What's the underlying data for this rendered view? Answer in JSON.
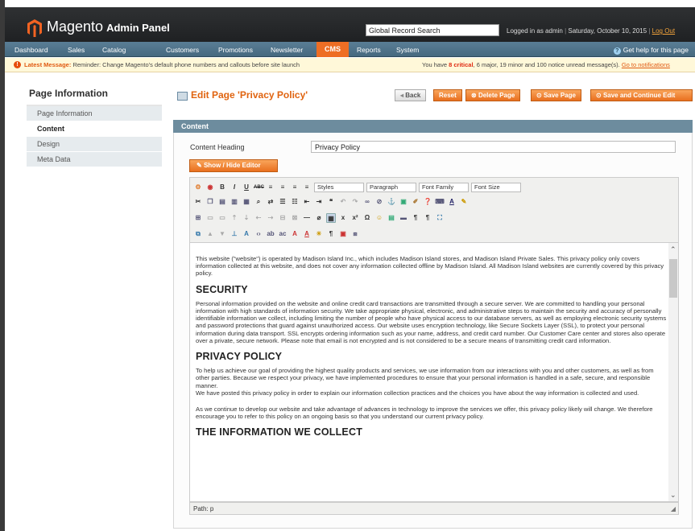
{
  "header": {
    "logo_main": "Magento",
    "logo_sub": "Admin Panel",
    "search_value": "Global Record Search",
    "logged_in": "Logged in as admin",
    "date": "Saturday, October 10, 2015",
    "logout": "Log Out"
  },
  "nav": {
    "items": [
      "Dashboard",
      "Sales",
      "Catalog",
      "Customers",
      "Promotions",
      "Newsletter",
      "CMS",
      "Reports",
      "System"
    ],
    "help": "Get help for this page"
  },
  "message": {
    "label": "Latest Message:",
    "text": "Reminder: Change Magento's default phone numbers and callouts before site launch",
    "pre": "You have",
    "critical": "8 critical",
    "rest": ", 6 major, 19 minor and 100 notice unread message(s).",
    "link": "Go to notifications"
  },
  "sidebar": {
    "title": "Page Information",
    "items": [
      {
        "label": "Page Information"
      },
      {
        "label": "Content"
      },
      {
        "label": "Design"
      },
      {
        "label": "Meta Data"
      }
    ]
  },
  "page": {
    "title": "Edit Page 'Privacy Policy'",
    "buttons": {
      "back": "Back",
      "reset": "Reset",
      "delete": "Delete Page",
      "save": "Save Page",
      "save_continue": "Save and Continue Edit"
    }
  },
  "content": {
    "section_title": "Content",
    "heading_label": "Content Heading",
    "heading_value": "Privacy Policy",
    "toggle_editor": "Show / Hide Editor",
    "toolbar": {
      "styles": "Styles",
      "format": "Paragraph",
      "font_family": "Font Family",
      "font_size": "Font Size"
    },
    "editor": {
      "intro": "This website (\"website\") is operated by Madison Island Inc., which includes Madison Island stores, and Madison Island Private Sales. This privacy policy only covers information collected at this website, and does not cover any information collected offline by Madison Island. All Madison Island websites are currently covered by this privacy policy.",
      "h_security": "SECURITY",
      "security": "Personal information provided on the website and online credit card transactions are transmitted through a secure server. We are committed to handling your personal information with high standards of information security. We take appropriate physical, electronic, and administrative steps to maintain the security and accuracy of personally identifiable information we collect, including limiting the number of people who have physical access to our database servers, as well as employing electronic security systems and password protections that guard against unauthorized access. Our website uses encryption technology, like Secure Sockets Layer (SSL), to protect your personal information during data transport. SSL encrypts ordering information such as your name, address, and credit card number. Our Customer Care center and stores also operate over a private, secure network. Please note that email is not encrypted and is not considered to be a secure means of transmitting credit card information.",
      "h_privacy": "PRIVACY POLICY",
      "privacy1": "To help us achieve our goal of providing the highest quality products and services, we use information from our interactions with you and other customers, as well as from other parties. Because we respect your privacy, we have implemented procedures to ensure that your personal information is handled in a safe, secure, and responsible manner.",
      "privacy2": "We have posted this privacy policy in order to explain our information collection practices and the choices you have about the way information is collected and used.",
      "privacy3": "As we continue to develop our website and take advantage of advances in technology to improve the services we offer, this privacy policy likely will change. We therefore encourage you to refer to this policy on an ongoing basis so that you understand our current privacy policy.",
      "h_collect": "THE INFORMATION WE COLLECT"
    },
    "path": "Path: p"
  },
  "colors": {
    "accent": "#ee6e24",
    "nav": "#4f7389",
    "section": "#6d8c9e"
  }
}
